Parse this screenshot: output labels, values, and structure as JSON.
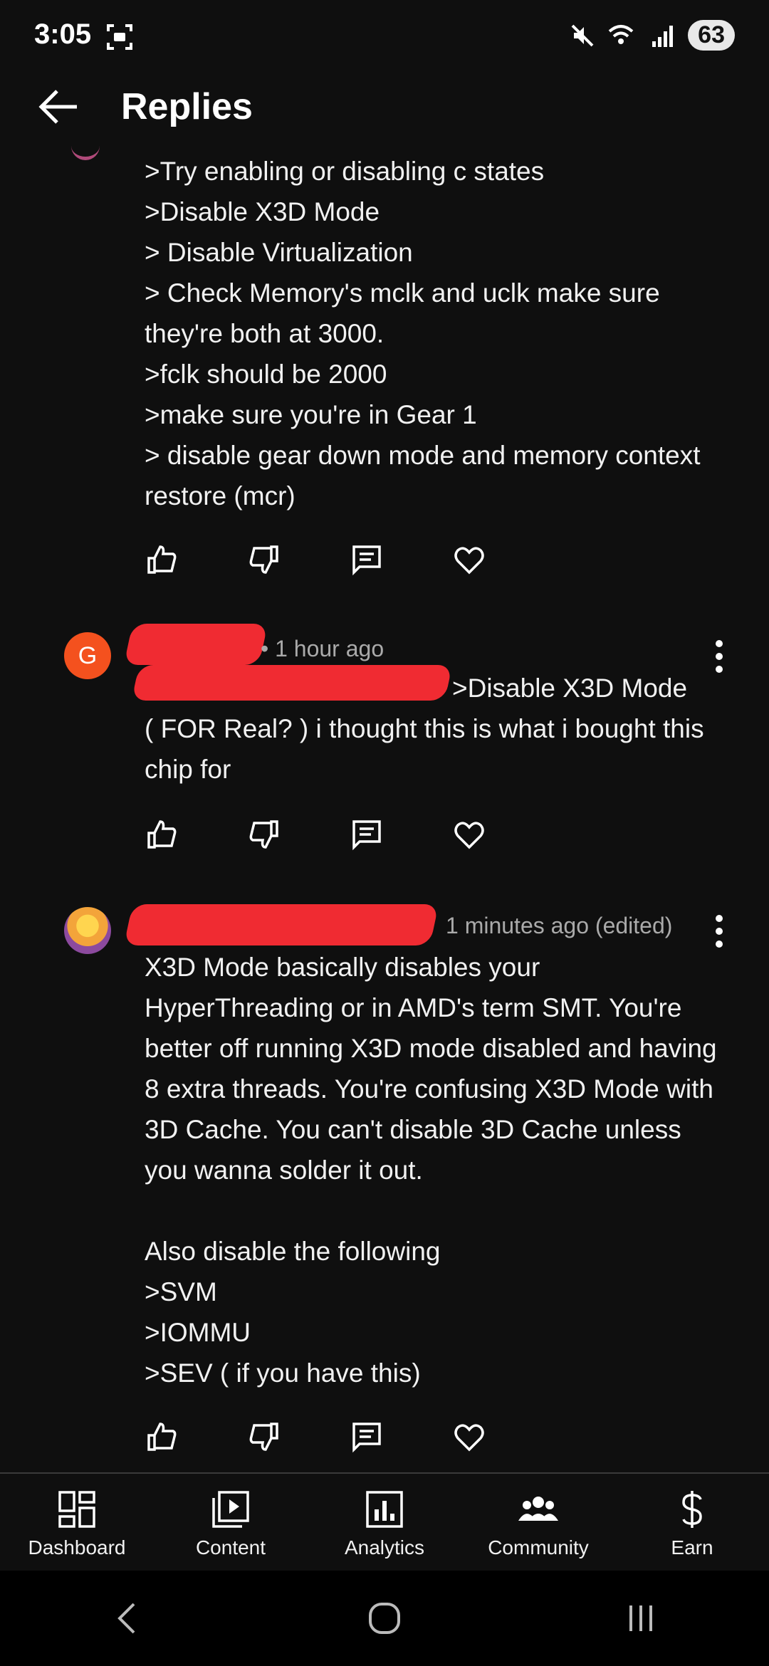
{
  "status_bar": {
    "time": "3:05",
    "battery": "63"
  },
  "header": {
    "title": "Replies"
  },
  "comments": [
    {
      "text": ">Try enabling or disabling c states\n>Disable X3D Mode\n> Disable Virtualization\n> Check Memory's mclk and uclk make sure they're both at 3000.\n>fclk should be 2000\n>make sure you're in Gear 1\n> disable gear down mode and memory context restore (mcr)"
    },
    {
      "avatar_letter": "G",
      "time": "• 1 hour ago",
      "text": ">Disable X3D Mode\n( FOR Real? ) i thought this is what i bought this chip for"
    },
    {
      "time": "1 minutes ago (edited)",
      "text": "X3D Mode basically disables your HyperThreading or in AMD's term SMT. You're better off running X3D mode disabled and having 8 extra threads. You're confusing X3D Mode with 3D Cache. You can't disable 3D Cache unless you wanna solder it out.\n\nAlso disable the following\n>SVM\n>IOMMU\n>SEV ( if you have this)"
    }
  ],
  "bottom_nav": [
    {
      "label": "Dashboard",
      "icon": "dashboard-icon"
    },
    {
      "label": "Content",
      "icon": "content-icon"
    },
    {
      "label": "Analytics",
      "icon": "analytics-icon"
    },
    {
      "label": "Community",
      "icon": "community-icon"
    },
    {
      "label": "Earn",
      "icon": "earn-icon"
    }
  ]
}
